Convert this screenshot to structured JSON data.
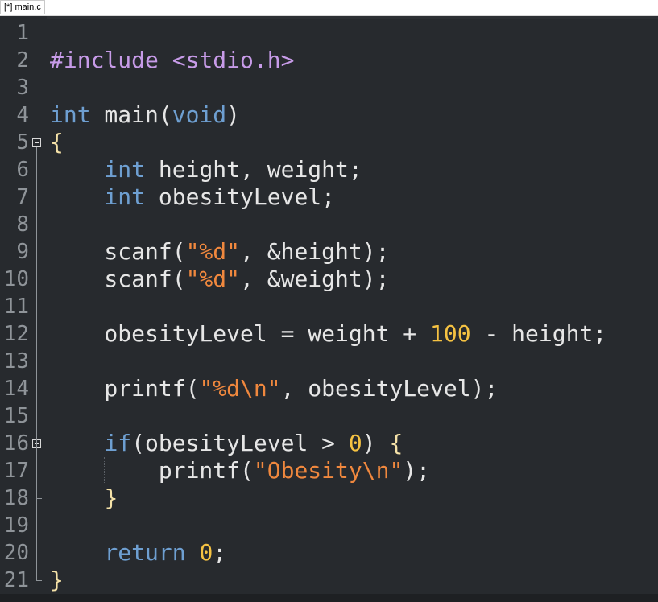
{
  "tab": {
    "title": "[*] main.c"
  },
  "editor": {
    "line_numbers": [
      "1",
      "2",
      "3",
      "4",
      "5",
      "6",
      "7",
      "8",
      "9",
      "10",
      "11",
      "12",
      "13",
      "14",
      "15",
      "16",
      "17",
      "18",
      "19",
      "20",
      "21"
    ],
    "lines": [
      [],
      [
        {
          "t": "#include ",
          "c": "pp"
        },
        {
          "t": "<stdio.h>",
          "c": "inc"
        }
      ],
      [],
      [
        {
          "t": "int",
          "c": "kw"
        },
        {
          "t": " main",
          "c": "fn"
        },
        {
          "t": "(",
          "c": "par"
        },
        {
          "t": "void",
          "c": "kw"
        },
        {
          "t": ")",
          "c": "par"
        }
      ],
      [
        {
          "t": "{",
          "c": "brace"
        }
      ],
      [
        {
          "t": "    ",
          "c": "op"
        },
        {
          "t": "int",
          "c": "kw"
        },
        {
          "t": " height, weight;",
          "c": "fn"
        }
      ],
      [
        {
          "t": "    ",
          "c": "op"
        },
        {
          "t": "int",
          "c": "kw"
        },
        {
          "t": " obesityLevel;",
          "c": "fn"
        }
      ],
      [],
      [
        {
          "t": "    scanf(",
          "c": "fn"
        },
        {
          "t": "\"%d\"",
          "c": "str"
        },
        {
          "t": ", &height);",
          "c": "fn"
        }
      ],
      [
        {
          "t": "    scanf(",
          "c": "fn"
        },
        {
          "t": "\"%d\"",
          "c": "str"
        },
        {
          "t": ", &weight);",
          "c": "fn"
        }
      ],
      [],
      [
        {
          "t": "    obesityLevel = weight + ",
          "c": "fn"
        },
        {
          "t": "100",
          "c": "num"
        },
        {
          "t": " - height;",
          "c": "fn"
        }
      ],
      [],
      [
        {
          "t": "    printf(",
          "c": "fn"
        },
        {
          "t": "\"%d\\n\"",
          "c": "str"
        },
        {
          "t": ", obesityLevel);",
          "c": "fn"
        }
      ],
      [],
      [
        {
          "t": "    ",
          "c": "op"
        },
        {
          "t": "if",
          "c": "kw"
        },
        {
          "t": "(obesityLevel > ",
          "c": "fn"
        },
        {
          "t": "0",
          "c": "num"
        },
        {
          "t": ") ",
          "c": "fn"
        },
        {
          "t": "{",
          "c": "brace"
        }
      ],
      [
        {
          "t": "        printf(",
          "c": "fn"
        },
        {
          "t": "\"Obesity\\n\"",
          "c": "str"
        },
        {
          "t": ");",
          "c": "fn"
        }
      ],
      [
        {
          "t": "    ",
          "c": "op"
        },
        {
          "t": "}",
          "c": "brace"
        }
      ],
      [],
      [
        {
          "t": "    ",
          "c": "op"
        },
        {
          "t": "return",
          "c": "kw"
        },
        {
          "t": " ",
          "c": "fn"
        },
        {
          "t": "0",
          "c": "num"
        },
        {
          "t": ";",
          "c": "fn"
        }
      ],
      [
        {
          "t": "}",
          "c": "brace"
        }
      ]
    ]
  }
}
